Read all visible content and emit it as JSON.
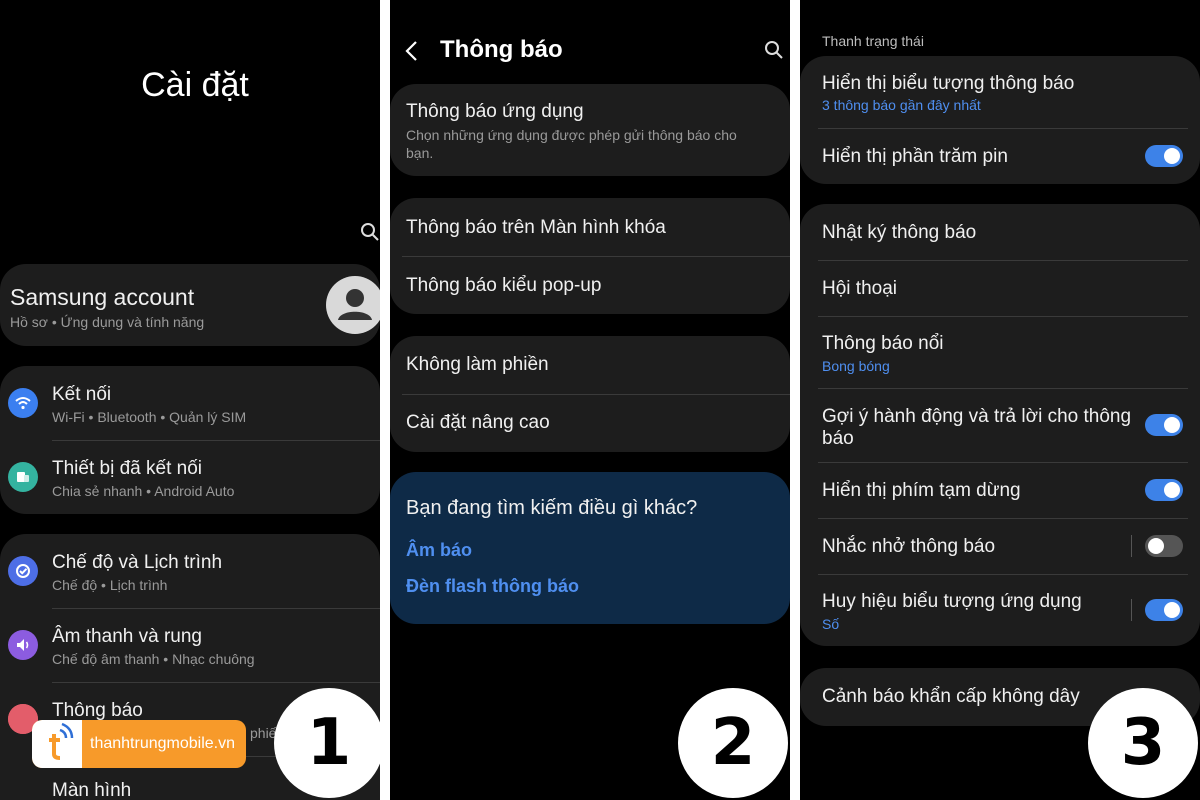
{
  "panel1": {
    "heading": "Cài đặt",
    "account": {
      "title": "Samsung account",
      "subtitle": "Hồ sơ • Ứng dụng và tính năng"
    },
    "group1": [
      {
        "title": "Kết nối",
        "subtitle": "Wi-Fi • Bluetooth • Quản lý SIM",
        "icon": "wifi-icon",
        "color": "#3b7ff0"
      },
      {
        "title": "Thiết bị đã kết nối",
        "subtitle": "Chia sẻ nhanh • Android Auto",
        "icon": "connected-devices-icon",
        "color": "#34b3a0"
      }
    ],
    "group2": [
      {
        "title": "Chế độ và Lịch trình",
        "subtitle": "Chế độ • Lịch trình",
        "icon": "modes-icon",
        "color": "#4d6ee6"
      },
      {
        "title": "Âm thanh và rung",
        "subtitle": "Chế độ âm thanh • Nhạc chuông",
        "icon": "sound-icon",
        "color": "#8c5ce0"
      },
      {
        "title": "Thông báo",
        "subtitle": "phiế",
        "icon": "notification-icon",
        "color": "#e35d6a"
      }
    ],
    "cut_item": "Màn hình"
  },
  "panel2": {
    "header_title": "Thông báo",
    "card1": {
      "title": "Thông báo ứng dụng",
      "subtitle_line1": "Chọn những ứng dụng được phép gửi thông báo cho",
      "subtitle_line2": "bạn."
    },
    "card2": [
      "Thông báo trên Màn hình khóa",
      "Thông báo kiểu pop-up"
    ],
    "card3": [
      "Không làm phiền",
      "Cài đặt nâng cao"
    ],
    "suggest": {
      "title": "Bạn đang tìm kiếm điều gì khác?",
      "links": [
        "Âm báo",
        "Đèn flash thông báo"
      ]
    }
  },
  "panel3": {
    "section_label": "Thanh trạng thái",
    "card1": [
      {
        "title": "Hiển thị biểu tượng thông báo",
        "subtitle": "3 thông báo gần đây nhất"
      },
      {
        "title": "Hiển thị phần trăm pin",
        "toggle": true
      }
    ],
    "card2": [
      {
        "title": "Nhật ký thông báo"
      },
      {
        "title": "Hội thoại"
      },
      {
        "title": "Thông báo nổi",
        "subtitle": "Bong bóng"
      },
      {
        "title_line1": "Gợi ý hành động và trả lời cho thông",
        "title_line2": "báo",
        "toggle": true
      },
      {
        "title": "Hiển thị phím tạm dừng",
        "toggle": true
      },
      {
        "title": "Nhắc nhở thông báo",
        "toggle": false
      },
      {
        "title": "Huy hiệu biểu tượng ứng dụng",
        "subtitle": "Số",
        "toggle": true
      }
    ],
    "card3": "Cảnh báo khẩn cấp không dây"
  },
  "steps": [
    "1",
    "2",
    "3"
  ],
  "brand": {
    "text": "thanhtrungmobile.vn",
    "color": "#f79a2a"
  }
}
